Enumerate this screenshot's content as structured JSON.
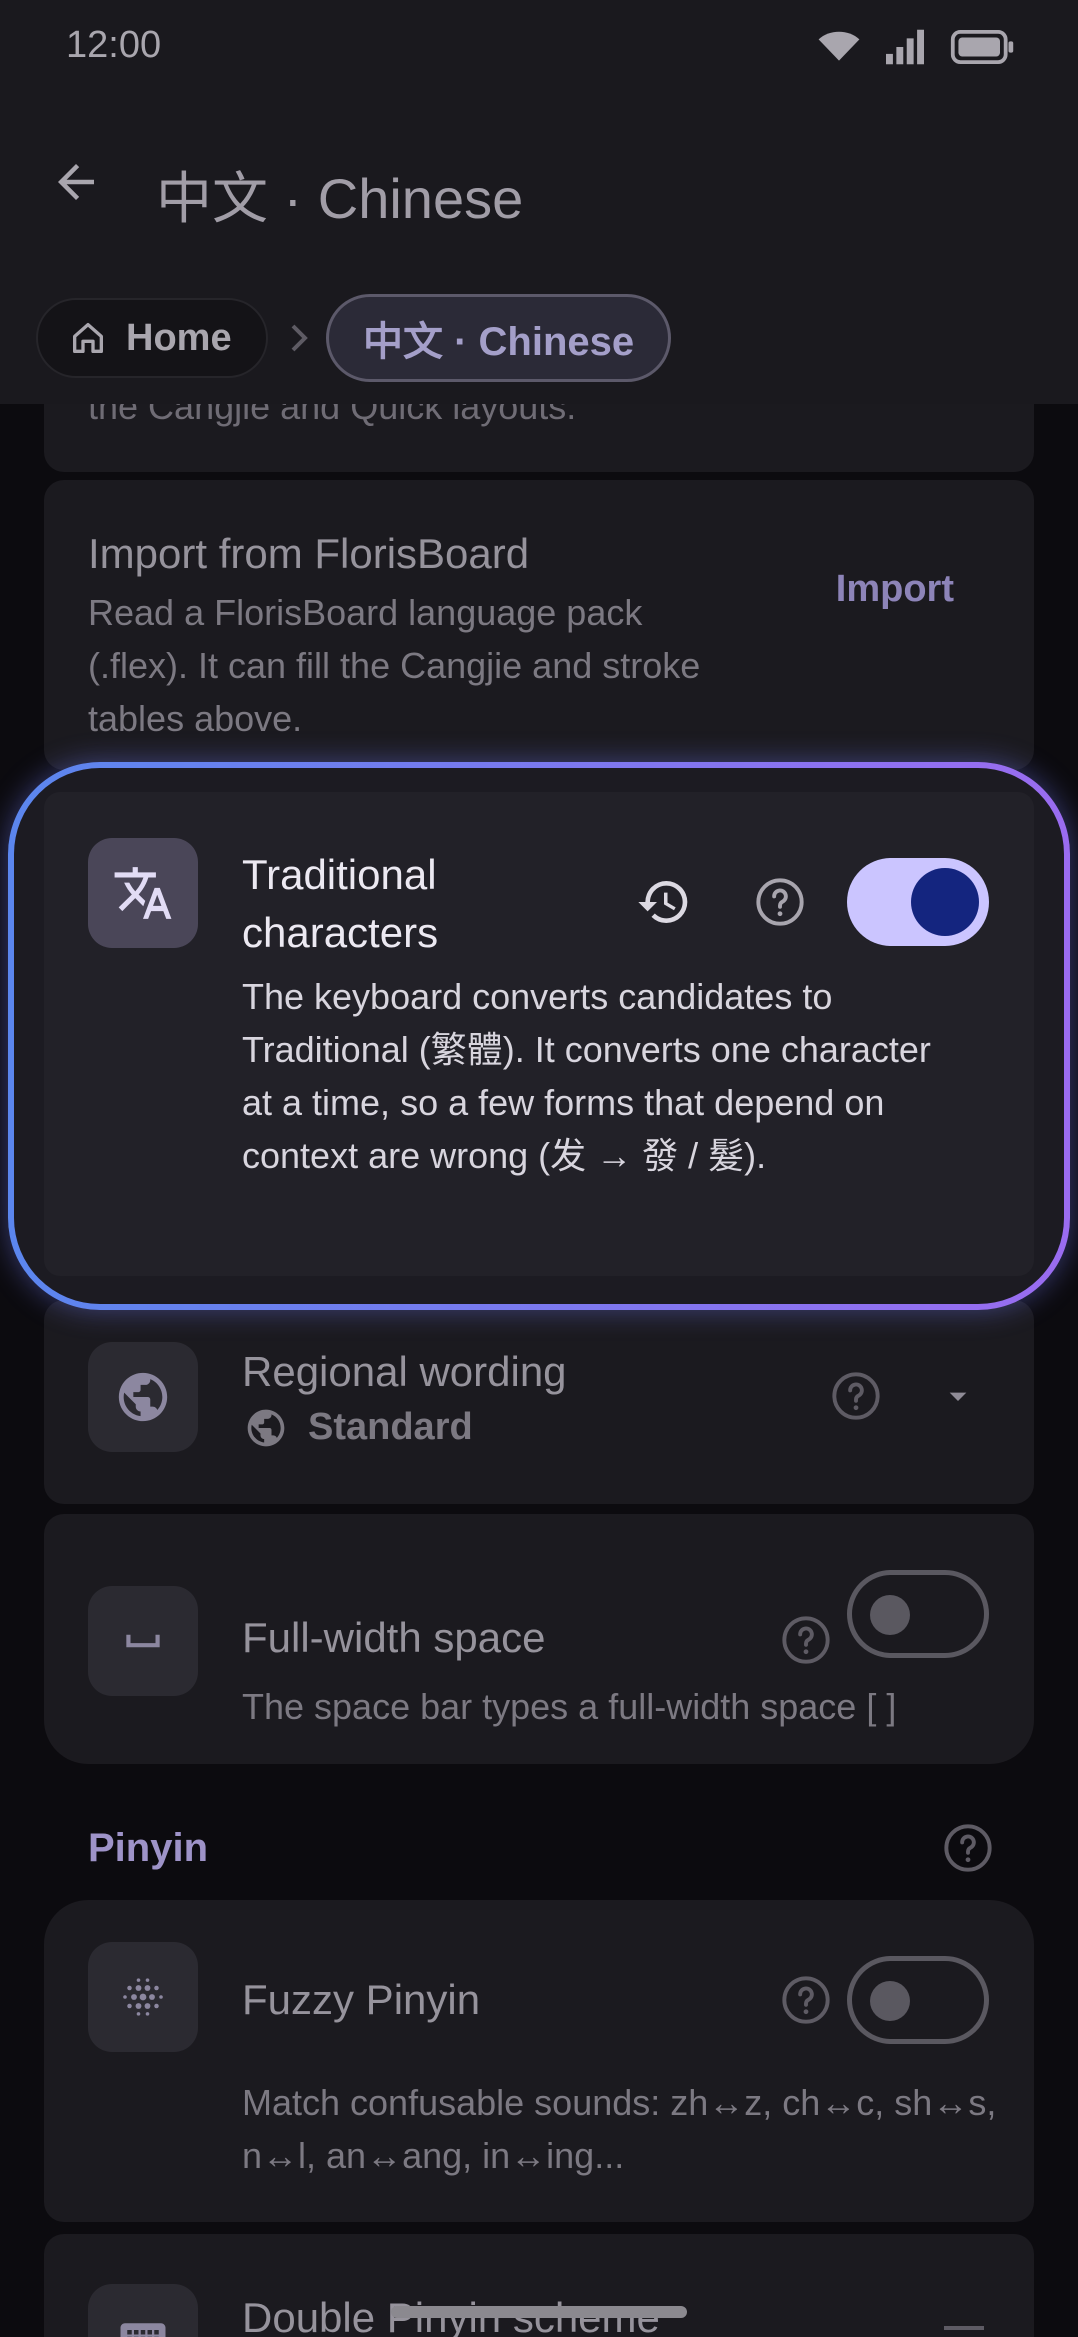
{
  "status": {
    "time": "12:00"
  },
  "header": {
    "title": "中文 · Chinese",
    "breadcrumb": {
      "home": "Home",
      "current": "中文 · Chinese"
    }
  },
  "cut_text": "the Cangjie and Quick layouts.",
  "import_card": {
    "title": "Import from FlorisBoard",
    "description": "Read a FlorisBoard language pack (.flex). It can fill the Cangjie and stroke tables above.",
    "action": "Import"
  },
  "traditional": {
    "title": "Traditional characters",
    "description": "The keyboard converts candidates to Traditional (繁體). It converts one character at a time, so a few forms that depend on context are wrong (发 → 發 / 髮).",
    "enabled": true
  },
  "regional": {
    "title": "Regional wording",
    "value": "Standard"
  },
  "fullwidth": {
    "title": "Full-width space",
    "description": "The space bar types a full-width space [ ]",
    "enabled": false
  },
  "pinyin_section": {
    "label": "Pinyin"
  },
  "fuzzy": {
    "title": "Fuzzy Pinyin",
    "description": "Match confusable sounds: zh↔z, ch↔c, sh↔s, n↔l, an↔ang, in↔ing...",
    "enabled": false
  },
  "double_pinyin": {
    "title": "Double Pinyin scheme"
  }
}
